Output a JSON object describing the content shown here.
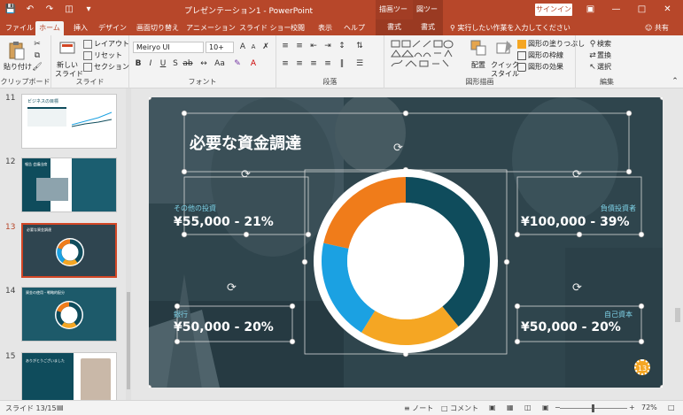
{
  "titlebar": {
    "doc_title": "プレゼンテーション1 - PowerPoint",
    "context1": "描画ツール",
    "context2": "図ツール",
    "signin": "サインイン"
  },
  "tabs": {
    "file": "ファイル",
    "home": "ホーム",
    "insert": "挿入",
    "design": "デザイン",
    "transitions": "画面切り替え",
    "animations": "アニメーション",
    "slideshow": "スライド ショー",
    "review": "校閲",
    "view": "表示",
    "help": "ヘルプ",
    "format1": "書式",
    "format2": "書式",
    "tellme": "実行したい作業を入力してください",
    "share": "共有"
  },
  "ribbon": {
    "clipboard": {
      "paste": "貼り付け",
      "label": "クリップボード"
    },
    "slides": {
      "new_slide": "新しい",
      "new_slide2": "スライド",
      "layout": "レイアウト",
      "reset": "リセット",
      "section": "セクション",
      "label": "スライド"
    },
    "font": {
      "family": "Meiryo UI",
      "size": "10+",
      "label": "フォント"
    },
    "paragraph": {
      "label": "段落"
    },
    "drawing": {
      "arrange": "配置",
      "quick_style": "クイック",
      "quick_style2": "スタイル",
      "fill": "図形の塗りつぶし",
      "outline": "図形の枠線",
      "effects": "図形の効果",
      "label": "図形描画"
    },
    "editing": {
      "find": "検索",
      "replace": "置換",
      "select": "選択",
      "label": "編集"
    }
  },
  "thumbnails": [
    {
      "num": "11",
      "title": "ビジネスの目標"
    },
    {
      "num": "12",
      "title": "報告 会議出席"
    },
    {
      "num": "13",
      "title": "必要な資金調達"
    },
    {
      "num": "14",
      "title": "資金の使用・戦略的配分"
    },
    {
      "num": "15",
      "title": "ありがとうございました"
    }
  ],
  "slide": {
    "title": "必要な資金調達",
    "labels": {
      "other": {
        "caption": "その他の投資",
        "value": "¥55,000 - 21%"
      },
      "debt": {
        "caption": "負債投資者",
        "value": "¥100,000 - 39%"
      },
      "bank": {
        "caption": "銀行",
        "value": "¥50,000 - 20%"
      },
      "equity": {
        "caption": "自己資本",
        "value": "¥50,000 - 20%"
      }
    },
    "slide_number": "13",
    "colors": {
      "teal": "#0f4c5c",
      "orange": "#f07c1a",
      "blue": "#1ba1e2",
      "amber": "#f5a623"
    }
  },
  "chart_data": {
    "type": "pie",
    "categories": [
      "負債投資者",
      "自己資本",
      "銀行",
      "その他の投資"
    ],
    "values": [
      100000,
      50000,
      50000,
      55000
    ],
    "percents": [
      39,
      20,
      20,
      21
    ],
    "colors": [
      "#0f4c5c",
      "#f5a623",
      "#1ba1e2",
      "#f07c1a"
    ]
  },
  "status": {
    "slide_info": "スライド 13/15",
    "notes": "ノート",
    "comments": "コメント",
    "zoom": "72%"
  }
}
